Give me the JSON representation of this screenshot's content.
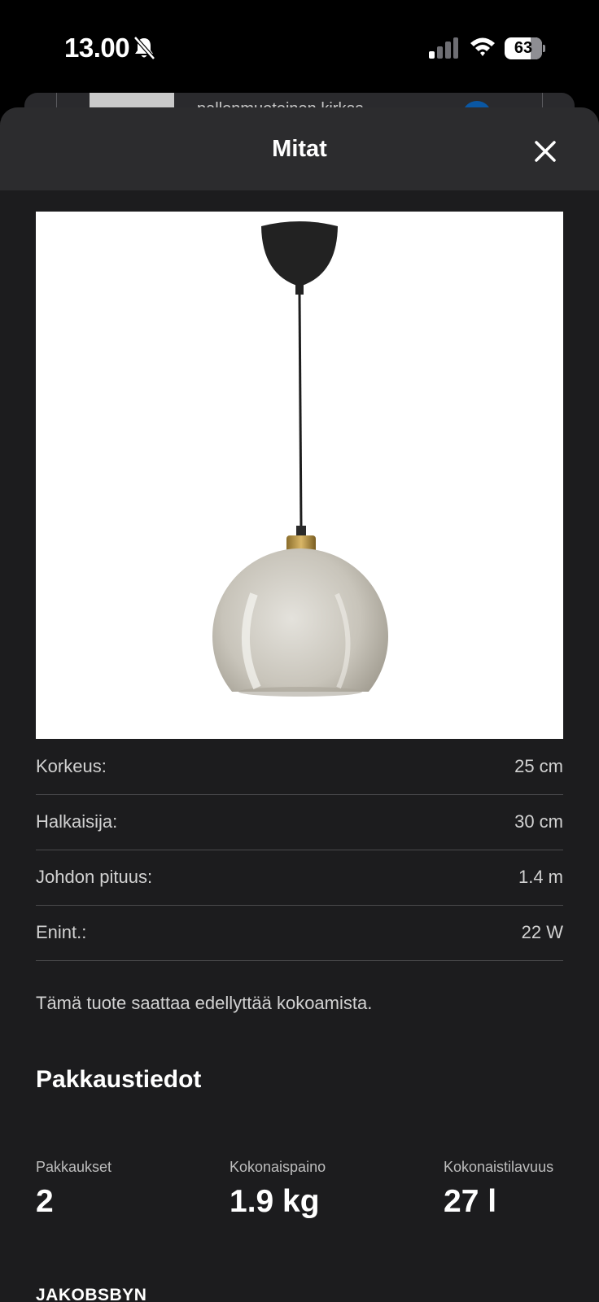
{
  "status_bar": {
    "time": "13.00",
    "battery_level": "63"
  },
  "background_card": {
    "text": "pallonmuotoinen kirkas"
  },
  "sheet": {
    "title": "Mitat",
    "close_icon": "close-icon"
  },
  "dimensions": [
    {
      "label": "Korkeus:",
      "value": "25 cm"
    },
    {
      "label": "Halkaisija:",
      "value": "30 cm"
    },
    {
      "label": "Johdon pituus:",
      "value": "1.4 m"
    },
    {
      "label": "Enint.:",
      "value": "22 W"
    }
  ],
  "assembly_note": "Tämä tuote saattaa edellyttää kokoamista.",
  "packaging": {
    "title": "Pakkaustiedot",
    "items": [
      {
        "label": "Pakkaukset",
        "value": "2"
      },
      {
        "label": "Kokonaispaino",
        "value": "1.9 kg"
      },
      {
        "label": "Kokonaistilavuus",
        "value": "27 l"
      }
    ]
  },
  "product_name": "JAKOBSBYN",
  "colors": {
    "sheet_bg": "#1c1c1e",
    "header_bg": "#2c2c2e",
    "divider": "#4a4a4d",
    "text_secondary": "#d2d2d2"
  }
}
